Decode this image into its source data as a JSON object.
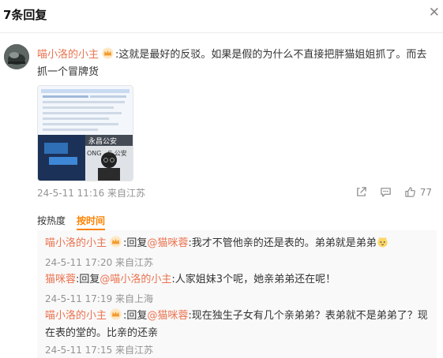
{
  "header": {
    "title": "7条回复"
  },
  "close_icon_char": "✕",
  "comment": {
    "username": "喵小洛的小主",
    "colon": ":",
    "text": "这就是最好的反驳。如果是假的为什么不直接把胖猫姐姐抓了。而去抓一个冒牌货",
    "image_text": {
      "sign": "永昌公安",
      "subtitle": "ONG",
      "sign2": "G 公安"
    },
    "timestamp": "24-5-11 11:16 来自江苏",
    "likes": "77"
  },
  "sort": {
    "hot": "按热度",
    "time": "按时间"
  },
  "replies": [
    {
      "username": "喵小洛的小主",
      "prefix": ":回复",
      "mention": "@猫咪蓉",
      "text": ":我才不管他亲的还是表的。弟弟就是弟弟",
      "meta": "24-5-11 17:20 来自江苏"
    },
    {
      "username": "猫咪蓉",
      "prefix": ":回复",
      "mention": "@喵小洛的小主",
      "text": ":人家姐妹3个呢，她亲弟弟还在呢！",
      "meta": "24-5-11 17:19 来自上海"
    },
    {
      "username": "喵小洛的小主",
      "prefix": ":回复",
      "mention": "@猫咪蓉",
      "text": ":现在独生子女有几个亲弟弟？表弟就不是弟弟了？现在表的堂的。比亲的还亲",
      "meta": "24-5-11 17:15 来自江苏"
    }
  ],
  "colors": {
    "username": "#eb7350",
    "active_sort": "#ff8200",
    "meta": "#939393"
  }
}
